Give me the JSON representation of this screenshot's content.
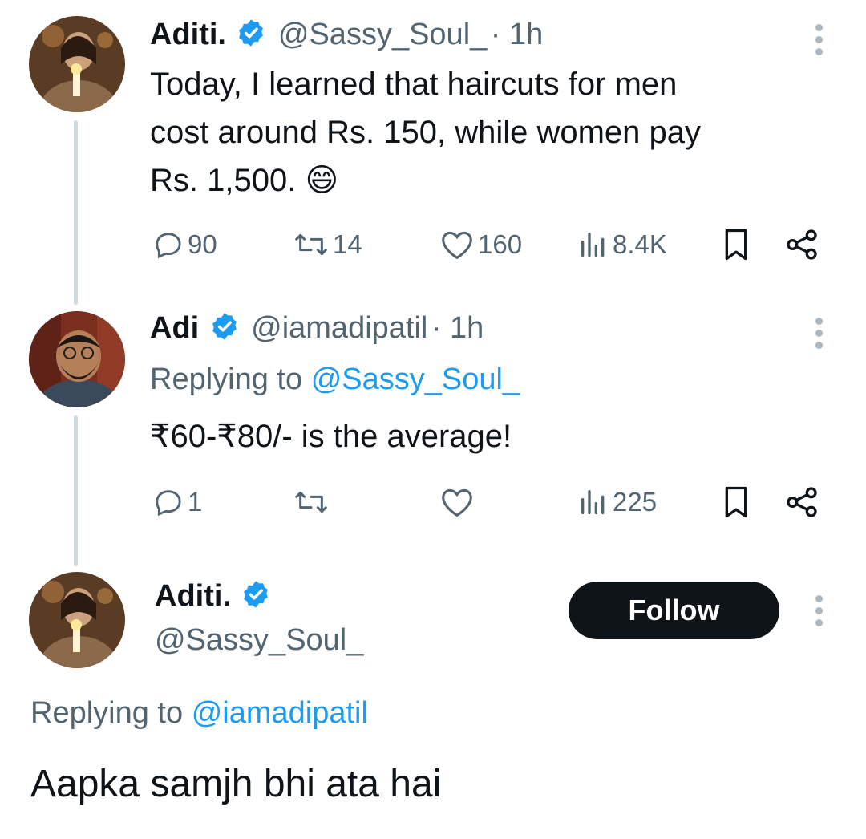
{
  "tweets": [
    {
      "name": "Aditi.",
      "handle": "@Sassy_Soul_",
      "time": "· 1h",
      "text_line1": "Today, I learned that haircuts for men",
      "text_line2": "cost around Rs. 150, while women pay",
      "text_line3": "Rs. 1,500.",
      "emoji": "😄",
      "stats": {
        "replies": "90",
        "retweets": "14",
        "likes": "160",
        "views": "8.4K"
      }
    },
    {
      "name": "Adi",
      "handle": "@iamadipatil",
      "time": "· 1h",
      "replying_prefix": "Replying to",
      "replying_to": "@Sassy_Soul_",
      "text": "₹60-₹80/- is the average!",
      "stats": {
        "replies": "1",
        "retweets": "",
        "likes": "",
        "views": "225"
      }
    }
  ],
  "focused": {
    "name": "Aditi.",
    "handle": "@Sassy_Soul_",
    "follow_label": "Follow",
    "replying_prefix": "Replying to",
    "replying_to": "@iamadipatil",
    "text": "Aapka samjh bhi ata hai"
  },
  "colors": {
    "accent": "#1d9bf0",
    "text": "#0f1419",
    "muted": "#536471",
    "thread_line": "#cfd9de"
  },
  "icons": [
    "verified-badge-icon",
    "more-options-icon",
    "reply-icon",
    "retweet-icon",
    "like-icon",
    "views-icon",
    "bookmark-icon",
    "share-icon"
  ]
}
